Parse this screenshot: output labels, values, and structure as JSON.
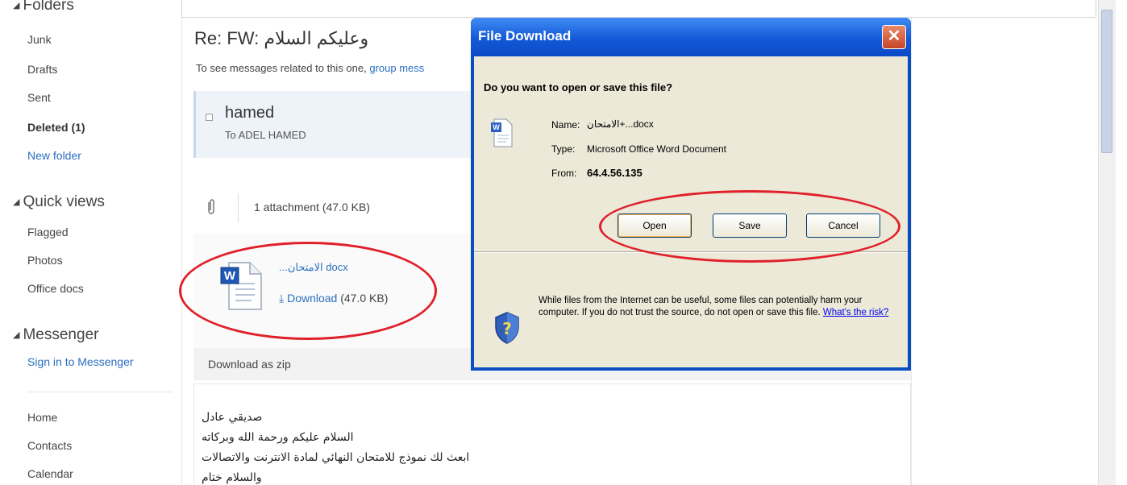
{
  "sidebar": {
    "folders_header": "Folders",
    "folders": [
      {
        "label": "Junk"
      },
      {
        "label": "Drafts"
      },
      {
        "label": "Sent"
      },
      {
        "label": "Deleted (1)"
      },
      {
        "label": "New folder"
      }
    ],
    "quick_views_header": "Quick views",
    "quick_views": [
      {
        "label": "Flagged"
      },
      {
        "label": "Photos"
      },
      {
        "label": "Office docs"
      }
    ],
    "messenger_header": "Messenger",
    "messenger_link": "Sign in to Messenger",
    "bottom": [
      {
        "label": "Home"
      },
      {
        "label": "Contacts"
      },
      {
        "label": "Calendar"
      }
    ]
  },
  "message": {
    "title": "Re: FW: وعليكم السلام",
    "related_text": "To see messages related to this one, ",
    "related_link": "group mess",
    "sender": "hamed",
    "to": "To ADEL HAMED",
    "attachment_count": "1 attachment (47.0 KB)",
    "file_name": "...الامتحان docx",
    "download_label": "Download",
    "download_size": "(47.0 KB)",
    "download_zip": "Download as zip",
    "body_lines": [
      "صديقي عادل",
      "السلام عليكم ورحمة الله وبركاته",
      "ابعث لك نموذج للامتحان النهائي لمادة الانترنت والاتصالات",
      "والسلام ختام"
    ]
  },
  "dialog": {
    "title": "File Download",
    "close_glyph": "✕",
    "question": "Do you want to open or save this file?",
    "name_label": "Name:",
    "name_value": "الامتحان+...docx",
    "type_label": "Type:",
    "type_value": "Microsoft Office Word Document",
    "from_label": "From:",
    "from_value": "64.4.56.135",
    "open_label": "Open",
    "save_label": "Save",
    "cancel_label": "Cancel",
    "warning_text": "While files from the Internet can be useful, some files can potentially harm your computer. If you do not trust the source, do not open or save this file. ",
    "risk_link": "What's the risk?"
  },
  "colors": {
    "annotation": "#e0202a",
    "link": "#2a6fc0",
    "titlebar": "#1459d8"
  }
}
